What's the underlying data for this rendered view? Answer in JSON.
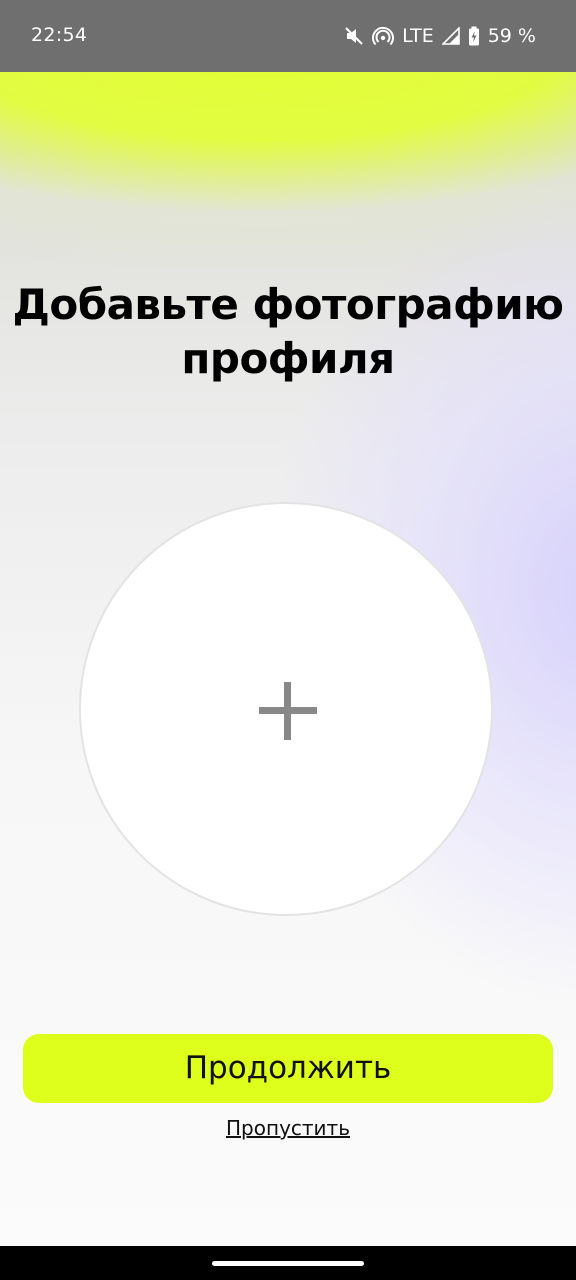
{
  "status_bar": {
    "time": "22:54",
    "network": "LTE",
    "battery": "59 %",
    "icons": [
      "mute-icon",
      "hotspot-icon",
      "signal-icon",
      "battery-charging-icon"
    ]
  },
  "page": {
    "title_line1": "Добавьте фотографию",
    "title_line2": "профиля",
    "avatar_icon": "plus-icon",
    "continue_label": "Продолжить",
    "skip_label": "Пропустить"
  },
  "colors": {
    "accent": "#DDFF1B",
    "status_bar": "#6F6F6F",
    "plus_icon": "#888888"
  }
}
